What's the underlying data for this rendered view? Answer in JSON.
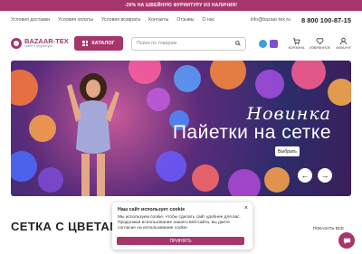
{
  "promo_bar": {
    "text": "-20% НА ШВЕЙНУЮ ФУРНИТУРУ ИЗ НАЛИЧИЯ!"
  },
  "nav": {
    "links": [
      "Условия доставки",
      "Условия оплаты",
      "Условия возврата",
      "Контакты",
      "Отзывы",
      "О нас"
    ],
    "email": "info@bazaar-tex.ru",
    "phone": "8 800 100-87-15"
  },
  "header": {
    "logo_title": "BAZAAR-TEX",
    "logo_subtitle": "ткани и фурнитура",
    "catalog_label": "КАТАЛОГ",
    "search_placeholder": "Поиск по товарам",
    "actions": [
      {
        "label": "КОРЗИНА",
        "icon": "cart-icon"
      },
      {
        "label": "ИЗБРАННОЕ",
        "icon": "heart-icon"
      },
      {
        "label": "АККАУНТ",
        "icon": "user-icon"
      }
    ]
  },
  "hero": {
    "title_script": "Новинка",
    "title_main": "Пайетки на сетке",
    "button_label": "Выбрать"
  },
  "section": {
    "title": "СЕТКА С ЦВЕТАМИ",
    "show_all": "ПОКАЗАТЬ ВСЕ"
  },
  "cookie": {
    "title": "Наш сайт использует cookie",
    "text": "Мы используем cookie, чтобы сделать сайт удобнее для вас. Продолжая использование нашего веб-сайта, вы даете согласие на использование cookie.",
    "accept_label": "ПРИНЯТЬ",
    "close": "×"
  },
  "colors": {
    "brand": "#a6356b"
  }
}
